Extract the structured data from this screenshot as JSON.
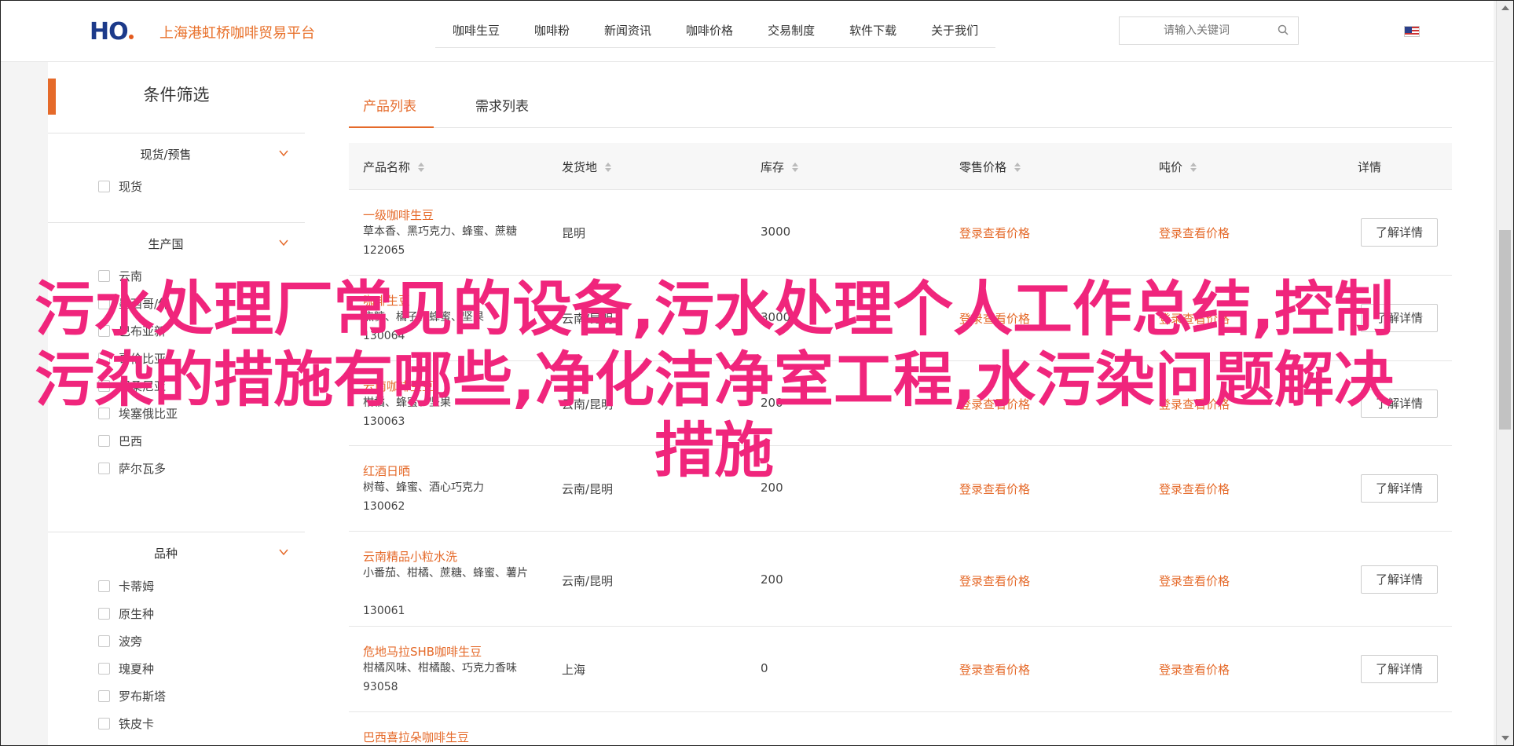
{
  "header": {
    "logo_text": "HO",
    "brand": "上海港虹桥咖啡贸易平台",
    "nav": [
      "咖啡生豆",
      "咖啡粉",
      "新闻资讯",
      "咖啡价格",
      "交易制度",
      "软件下载",
      "关于我们"
    ],
    "search_placeholder": "请输入关键词"
  },
  "sidebar": {
    "title": "条件筛选",
    "groups": [
      {
        "label": "现货/预售",
        "options": [
          "现货"
        ]
      },
      {
        "label": "生产国",
        "options": [
          "云南",
          "墨西哥/保",
          "巴布亚新",
          "哥伦比亚",
          "坦桑尼亚",
          "埃塞俄比亚",
          "巴西",
          "萨尔瓦多"
        ]
      },
      {
        "label": "品种",
        "options": [
          "卡蒂姆",
          "原生种",
          "波旁",
          "瑰夏种",
          "罗布斯塔",
          "铁皮卡"
        ]
      }
    ]
  },
  "main": {
    "tabs": [
      "产品列表",
      "需求列表"
    ],
    "columns": [
      "产品名称",
      "发货地",
      "库存",
      "零售价格",
      "吨价",
      "详情"
    ],
    "rows": [
      {
        "name": "一级咖啡生豆",
        "desc": "草本香、黑巧克力、蜂蜜、蔗糖",
        "id": "122065",
        "origin": "昆明",
        "stock": "3000",
        "retail": "登录查看价格",
        "ton": "登录查看价格",
        "detail": "了解详情"
      },
      {
        "name": "咖啡生豆",
        "desc": "焦糖、橘子、蜂蜜、坚果",
        "id": "130064",
        "origin": "云南/昆明",
        "stock": "30000",
        "retail": "登录查看价格",
        "ton": "登录查看价格",
        "detail": "了解详情"
      },
      {
        "name": "云南咖啡生豆",
        "desc": "柑橘、蜂蜜、坚果",
        "id": "130063",
        "origin": "云南/昆明",
        "stock": "200",
        "retail": "登录查看价格",
        "ton": "登录查看价格",
        "detail": "了解详情"
      },
      {
        "name": "红酒日晒",
        "desc": "树莓、蜂蜜、酒心巧克力",
        "id": "130062",
        "origin": "云南/昆明",
        "stock": "200",
        "retail": "登录查看价格",
        "ton": "登录查看价格",
        "detail": "了解详情"
      },
      {
        "name": "云南精品小粒水洗",
        "desc": "小番茄、柑橘、蔗糖、蜂蜜、薯片",
        "id": "130061",
        "origin": "云南/昆明",
        "stock": "200",
        "retail": "登录查看价格",
        "ton": "登录查看价格",
        "detail": "了解详情"
      },
      {
        "name": "危地马拉SHB咖啡生豆",
        "desc": "柑橘风味、柑橘酸、巧克力香味",
        "id": "93058",
        "origin": "上海",
        "stock": "0",
        "retail": "登录查看价格",
        "ton": "登录查看价格",
        "detail": "了解详情"
      },
      {
        "name": "巴西喜拉朵咖啡生豆",
        "desc": "",
        "id": "",
        "origin": "",
        "stock": "",
        "retail": "",
        "ton": "",
        "detail": ""
      }
    ]
  },
  "overlay": {
    "text": "污水处理厂常见的设备,污水处理个人工作总结,控制污染的措施有哪些,净化洁净室工程,水污染问题解决措施"
  },
  "colors": {
    "accent": "#e56a2a",
    "overlay": "#f0257c",
    "brand_blue": "#1c3a8a"
  }
}
